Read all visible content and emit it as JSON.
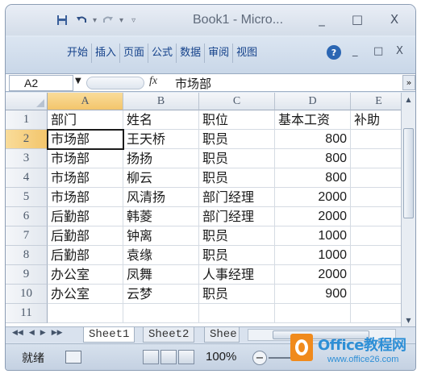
{
  "window": {
    "title": "Book1 - Micro...",
    "controls": [
      "_",
      "□",
      "X"
    ]
  },
  "quick_access": {
    "icons": [
      "save-icon",
      "undo-icon",
      "redo-icon",
      "customize-icon"
    ]
  },
  "ribbon": {
    "tabs": [
      "开始",
      "插入",
      "页面",
      "公式",
      "数据",
      "审阅",
      "视图"
    ],
    "help_label": "?",
    "controls": [
      "_",
      "□",
      "X"
    ]
  },
  "formula_bar": {
    "name_box": "A2",
    "fx_label": "fx",
    "content": "市场部",
    "expand": "»"
  },
  "grid": {
    "columns": [
      "A",
      "B",
      "C",
      "D",
      "E"
    ],
    "rows": [
      "1",
      "2",
      "3",
      "4",
      "5",
      "6",
      "7",
      "8",
      "9",
      "10",
      "11"
    ],
    "selected_cell": "A2",
    "cells": [
      [
        "部门",
        "姓名",
        "职位",
        "基本工资",
        "补助"
      ],
      [
        "市场部",
        "王天桥",
        "职员",
        "800",
        ""
      ],
      [
        "市场部",
        "扬扬",
        "职员",
        "800",
        ""
      ],
      [
        "市场部",
        "柳云",
        "职员",
        "800",
        ""
      ],
      [
        "市场部",
        "风清扬",
        "部门经理",
        "2000",
        ""
      ],
      [
        "后勤部",
        "韩菱",
        "部门经理",
        "2000",
        ""
      ],
      [
        "后勤部",
        "钟离",
        "职员",
        "1000",
        ""
      ],
      [
        "后勤部",
        "袁缘",
        "职员",
        "1000",
        ""
      ],
      [
        "办公室",
        "凤舞",
        "人事经理",
        "2000",
        ""
      ],
      [
        "办公室",
        "云梦",
        "职员",
        "900",
        ""
      ],
      [
        "",
        "",
        "",
        "",
        ""
      ]
    ]
  },
  "sheets": {
    "tabs": [
      "Sheet1",
      "Sheet2",
      "Shee"
    ],
    "active": "Sheet1"
  },
  "status_bar": {
    "text": "就绪",
    "zoom": "100%",
    "zoom_minus": "−"
  },
  "watermark": {
    "title": "Office教程网",
    "url": "www.office26.com"
  }
}
